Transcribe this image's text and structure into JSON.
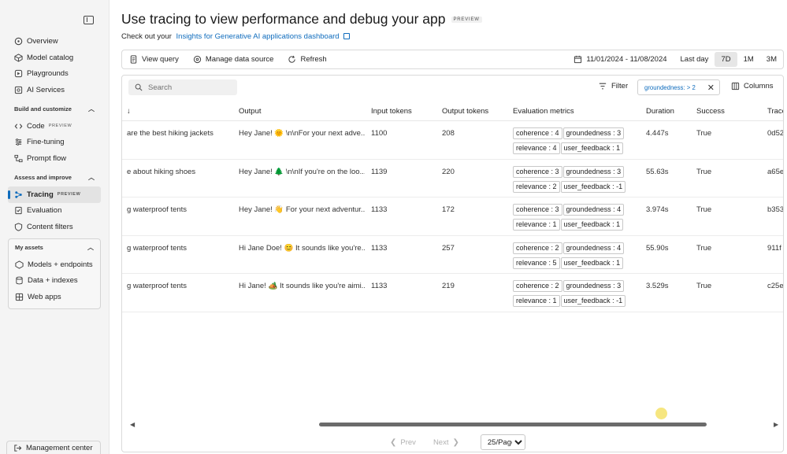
{
  "sidebar": {
    "items_top": [
      {
        "label": "Overview",
        "icon": "overview-icon"
      },
      {
        "label": "Model catalog",
        "icon": "model-catalog-icon"
      },
      {
        "label": "Playgrounds",
        "icon": "playground-icon"
      },
      {
        "label": "AI Services",
        "icon": "ai-services-icon"
      }
    ],
    "section_build": "Build and customize",
    "items_build": [
      {
        "label": "Code",
        "badge": "PREVIEW",
        "icon": "code-icon"
      },
      {
        "label": "Fine-tuning",
        "icon": "fine-tuning-icon"
      },
      {
        "label": "Prompt flow",
        "icon": "prompt-flow-icon"
      }
    ],
    "section_assess": "Assess and improve",
    "items_assess": [
      {
        "label": "Tracing",
        "badge": "PREVIEW",
        "icon": "tracing-icon",
        "active": true
      },
      {
        "label": "Evaluation",
        "icon": "evaluation-icon"
      },
      {
        "label": "Content filters",
        "icon": "content-filters-icon"
      }
    ],
    "section_assets": "My assets",
    "items_assets": [
      {
        "label": "Models + endpoints",
        "icon": "models-endpoints-icon"
      },
      {
        "label": "Data + indexes",
        "icon": "data-indexes-icon"
      },
      {
        "label": "Web apps",
        "icon": "web-apps-icon"
      }
    ],
    "management_center": "Management center"
  },
  "header": {
    "title": "Use tracing to view performance and debug your app",
    "title_badge": "PREVIEW",
    "subtitle_prefix": "Check out your",
    "subtitle_link": "Insights for Generative AI applications dashboard"
  },
  "toolbar": {
    "view_query": "View query",
    "manage_data_source": "Manage data source",
    "refresh": "Refresh",
    "date_range": "11/01/2024 - 11/08/2024",
    "ranges": [
      "Last day",
      "7D",
      "1M",
      "3M"
    ],
    "selected_range": "7D"
  },
  "table": {
    "search_placeholder": "Search",
    "filter_label": "Filter",
    "filter_chip": "groundedness: > 2",
    "columns_label": "Columns",
    "headers": {
      "sort_arrow": "↓",
      "output": "Output",
      "input_tokens": "Input tokens",
      "output_tokens": "Output tokens",
      "evaluation_metrics": "Evaluation metrics",
      "duration": "Duration",
      "success": "Success",
      "trace": "Trace"
    },
    "rows": [
      {
        "input": "are the best hiking jackets",
        "output": "Hey Jane! 🌞 \\n\\nFor your next adve...",
        "input_tokens": "1100",
        "output_tokens": "208",
        "coherence": "coherence : 4",
        "groundedness": "groundedness : 3",
        "relevance": "relevance : 4",
        "user_feedback": "user_feedback : 1",
        "duration": "4.447s",
        "success": "True",
        "trace": "0d52"
      },
      {
        "input": "e about hiking shoes",
        "output": "Hey Jane! 🌲 \\n\\nIf you're on the loo...",
        "input_tokens": "1139",
        "output_tokens": "220",
        "coherence": "coherence : 3",
        "groundedness": "groundedness : 3",
        "relevance": "relevance : 2",
        "user_feedback": "user_feedback : -1",
        "duration": "55.63s",
        "success": "True",
        "trace": "a65e"
      },
      {
        "input": "g waterproof tents",
        "output": "Hey Jane! 👋 For your next adventur...",
        "input_tokens": "1133",
        "output_tokens": "172",
        "coherence": "coherence : 3",
        "groundedness": "groundedness : 4",
        "relevance": "relevance : 1",
        "user_feedback": "user_feedback : 1",
        "duration": "3.974s",
        "success": "True",
        "trace": "b353"
      },
      {
        "input": "g waterproof tents",
        "output": "Hi Jane Doe! 😊 It sounds like you're...",
        "input_tokens": "1133",
        "output_tokens": "257",
        "coherence": "coherence : 2",
        "groundedness": "groundedness : 4",
        "relevance": "relevance : 5",
        "user_feedback": "user_feedback : 1",
        "duration": "55.90s",
        "success": "True",
        "trace": "911f"
      },
      {
        "input": "g waterproof tents",
        "output": "Hi Jane! 🏕️ It sounds like you're aimi...",
        "input_tokens": "1133",
        "output_tokens": "219",
        "coherence": "coherence : 2",
        "groundedness": "groundedness : 3",
        "relevance": "relevance : 1",
        "user_feedback": "user_feedback : -1",
        "duration": "3.529s",
        "success": "True",
        "trace": "c25e"
      }
    ]
  },
  "pagination": {
    "prev": "Prev",
    "next": "Next",
    "page_size": "25/Page"
  },
  "colors": {
    "accent": "#0f6cbd",
    "sidebar_bg": "#f4f4f4"
  }
}
